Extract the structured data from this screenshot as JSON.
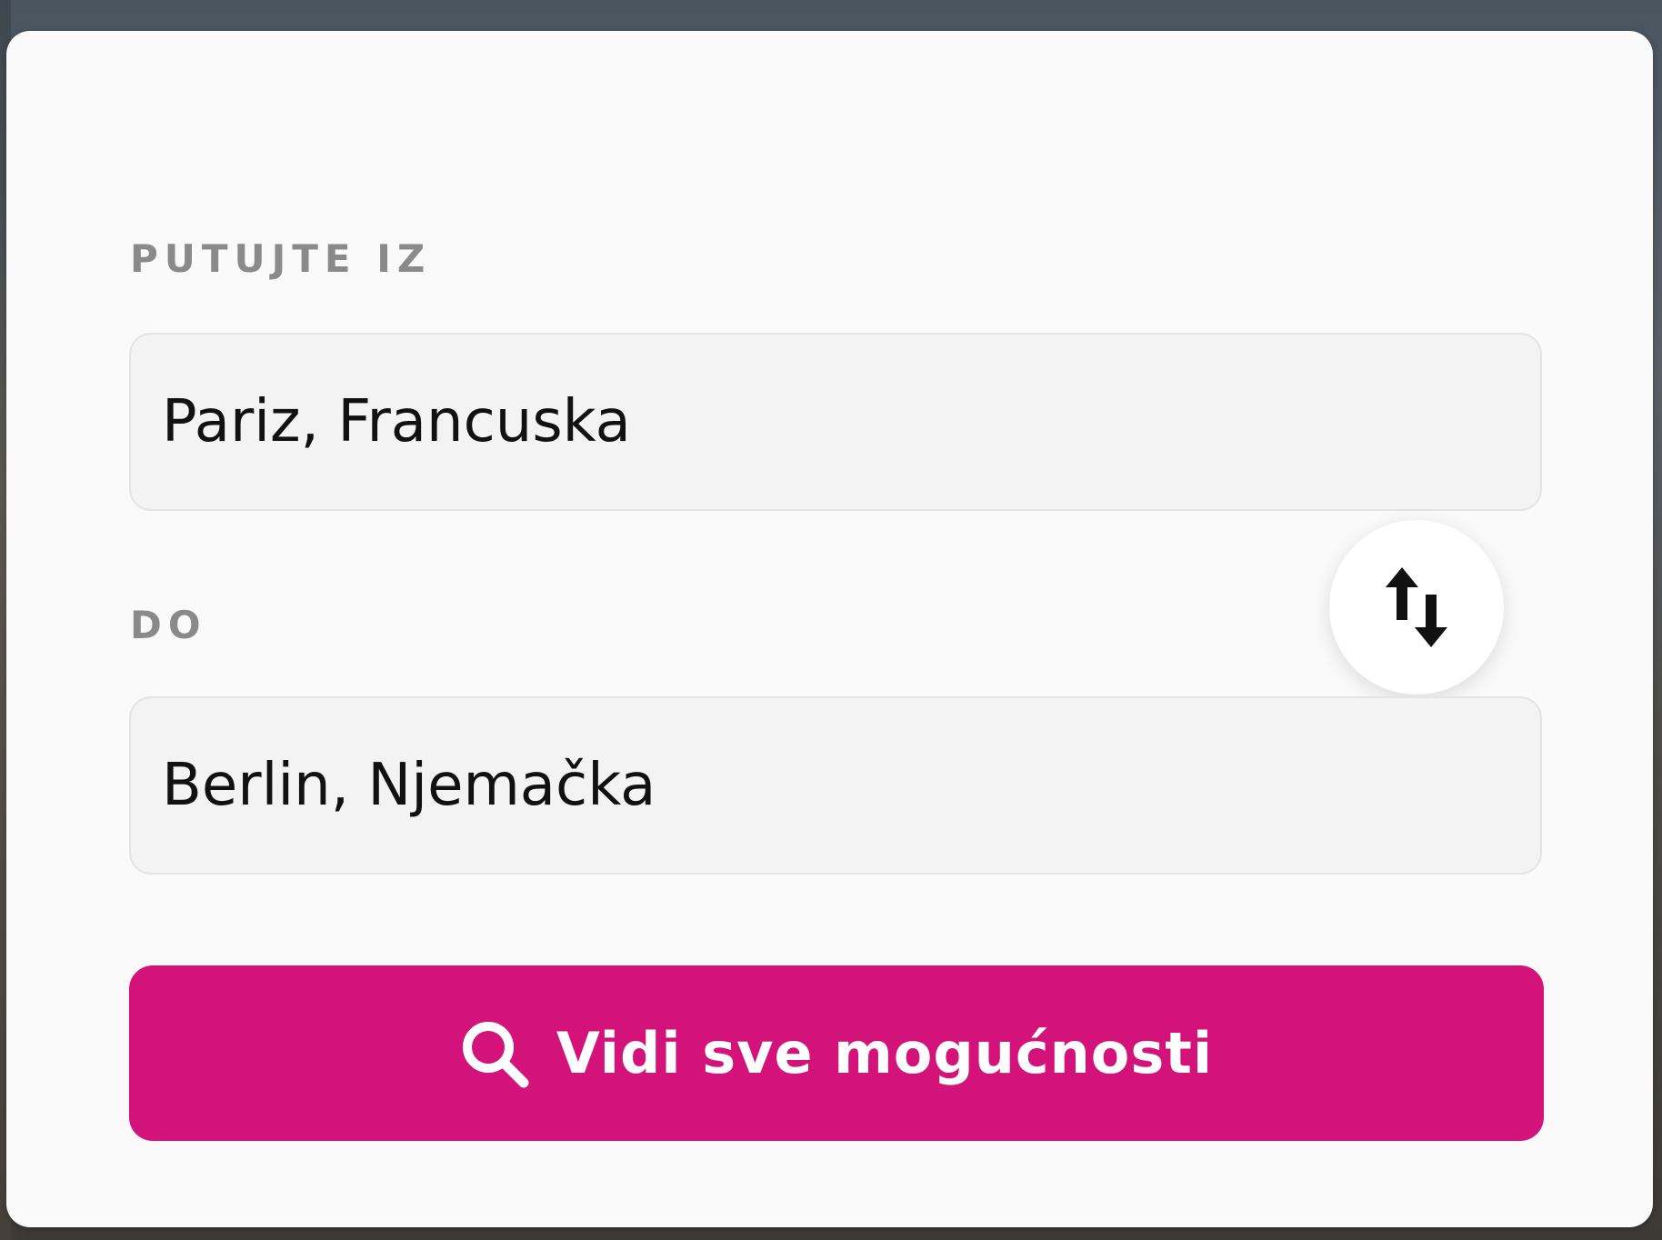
{
  "form": {
    "from_label": "PUTUJTE IZ",
    "from_value": "Pariz, Francuska",
    "to_label": "DO",
    "to_value": "Berlin, Njemačka",
    "search_button_label": "Vidi sve mogućnosti"
  },
  "icons": {
    "swap": "swap-vertical-arrows-icon",
    "search": "search-icon"
  },
  "colors": {
    "accent": "#d3137a",
    "card_background": "#fafafa",
    "field_background": "#f3f3f3",
    "label_color": "#8a8a8a"
  }
}
